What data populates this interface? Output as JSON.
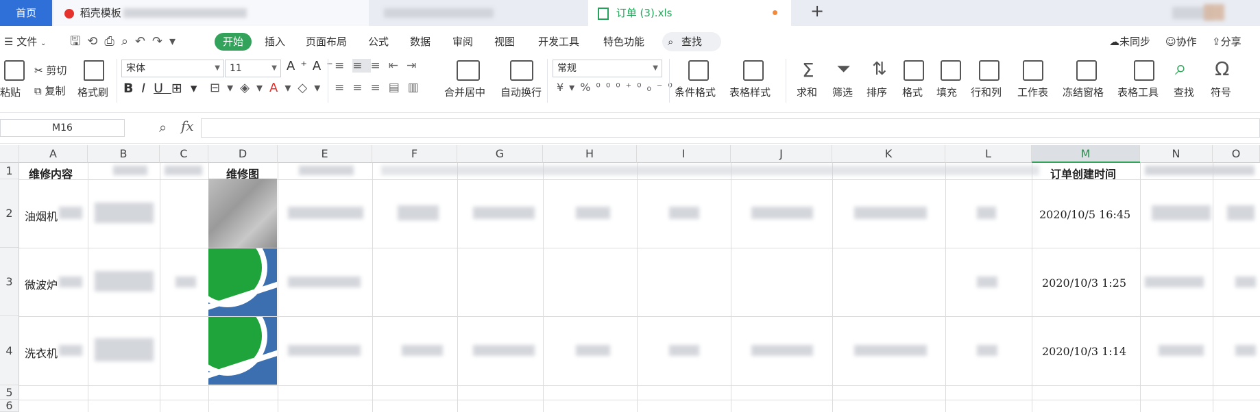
{
  "tabs": {
    "home": "首页",
    "template": "稻壳模板",
    "doc": "订单 (3).xls",
    "add": "+"
  },
  "menu": {
    "file": "文件",
    "items": [
      "开始",
      "插入",
      "页面布局",
      "公式",
      "数据",
      "审阅",
      "视图",
      "开发工具",
      "特色功能"
    ],
    "search": "查找",
    "unsync": "未同步",
    "collab": "协作",
    "share": "分享"
  },
  "ribbon": {
    "paste": "粘贴",
    "cut": "剪切",
    "copy": "复制",
    "format_painter": "格式刷",
    "font": "宋体",
    "font_size": "11",
    "merge": "合并居中",
    "wrap": "自动换行",
    "number_format": "常规",
    "cond_format": "条件格式",
    "table_style": "表格样式",
    "sum": "求和",
    "filter": "筛选",
    "sort": "排序",
    "format": "格式",
    "fill": "填充",
    "rowcol": "行和列",
    "sheet": "工作表",
    "freeze": "冻结窗格",
    "table_tools": "表格工具",
    "find": "查找",
    "symbol": "符号"
  },
  "formula_bar": {
    "name_box": "M16",
    "fx": "fx",
    "value": ""
  },
  "columns": [
    "A",
    "B",
    "C",
    "D",
    "E",
    "F",
    "G",
    "H",
    "I",
    "J",
    "K",
    "L",
    "M",
    "N",
    "O"
  ],
  "rows": [
    "1",
    "2",
    "3",
    "4",
    "5",
    "6"
  ],
  "cells": {
    "A1": "维修内容",
    "D1": "维修图",
    "M1": "订单创建时间",
    "A2": "油烟机",
    "A3": "微波炉",
    "A4": "洗衣机",
    "M2": "2020/10/5 16:45",
    "M3": "2020/10/3 1:25",
    "M4": "2020/10/3 1:14"
  },
  "colors": {
    "accent": "#33a25b",
    "home_tab": "#2f6fd8"
  }
}
